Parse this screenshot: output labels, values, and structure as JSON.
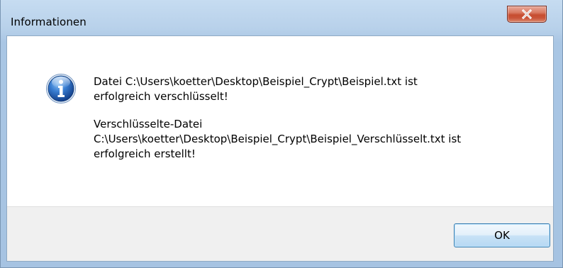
{
  "window": {
    "title": "Informationen"
  },
  "message": {
    "line1": "Datei C:\\Users\\koetter\\Desktop\\Beispiel_Crypt\\Beispiel.txt ist",
    "line2": "erfolgreich verschlüsselt!",
    "line3": "Verschlüsselte-Datei",
    "line4": "C:\\Users\\koetter\\Desktop\\Beispiel_Crypt\\Beispiel_Verschlüsselt.txt ist",
    "line5": "erfolgreich erstellt!"
  },
  "buttons": {
    "ok_label": "OK"
  },
  "icons": {
    "info": "info-icon",
    "close": "close-icon"
  },
  "colors": {
    "info_icon_blue": "#1f5fb5",
    "close_button_red": "#c74d30",
    "ok_button_border": "#3c7fb1"
  }
}
